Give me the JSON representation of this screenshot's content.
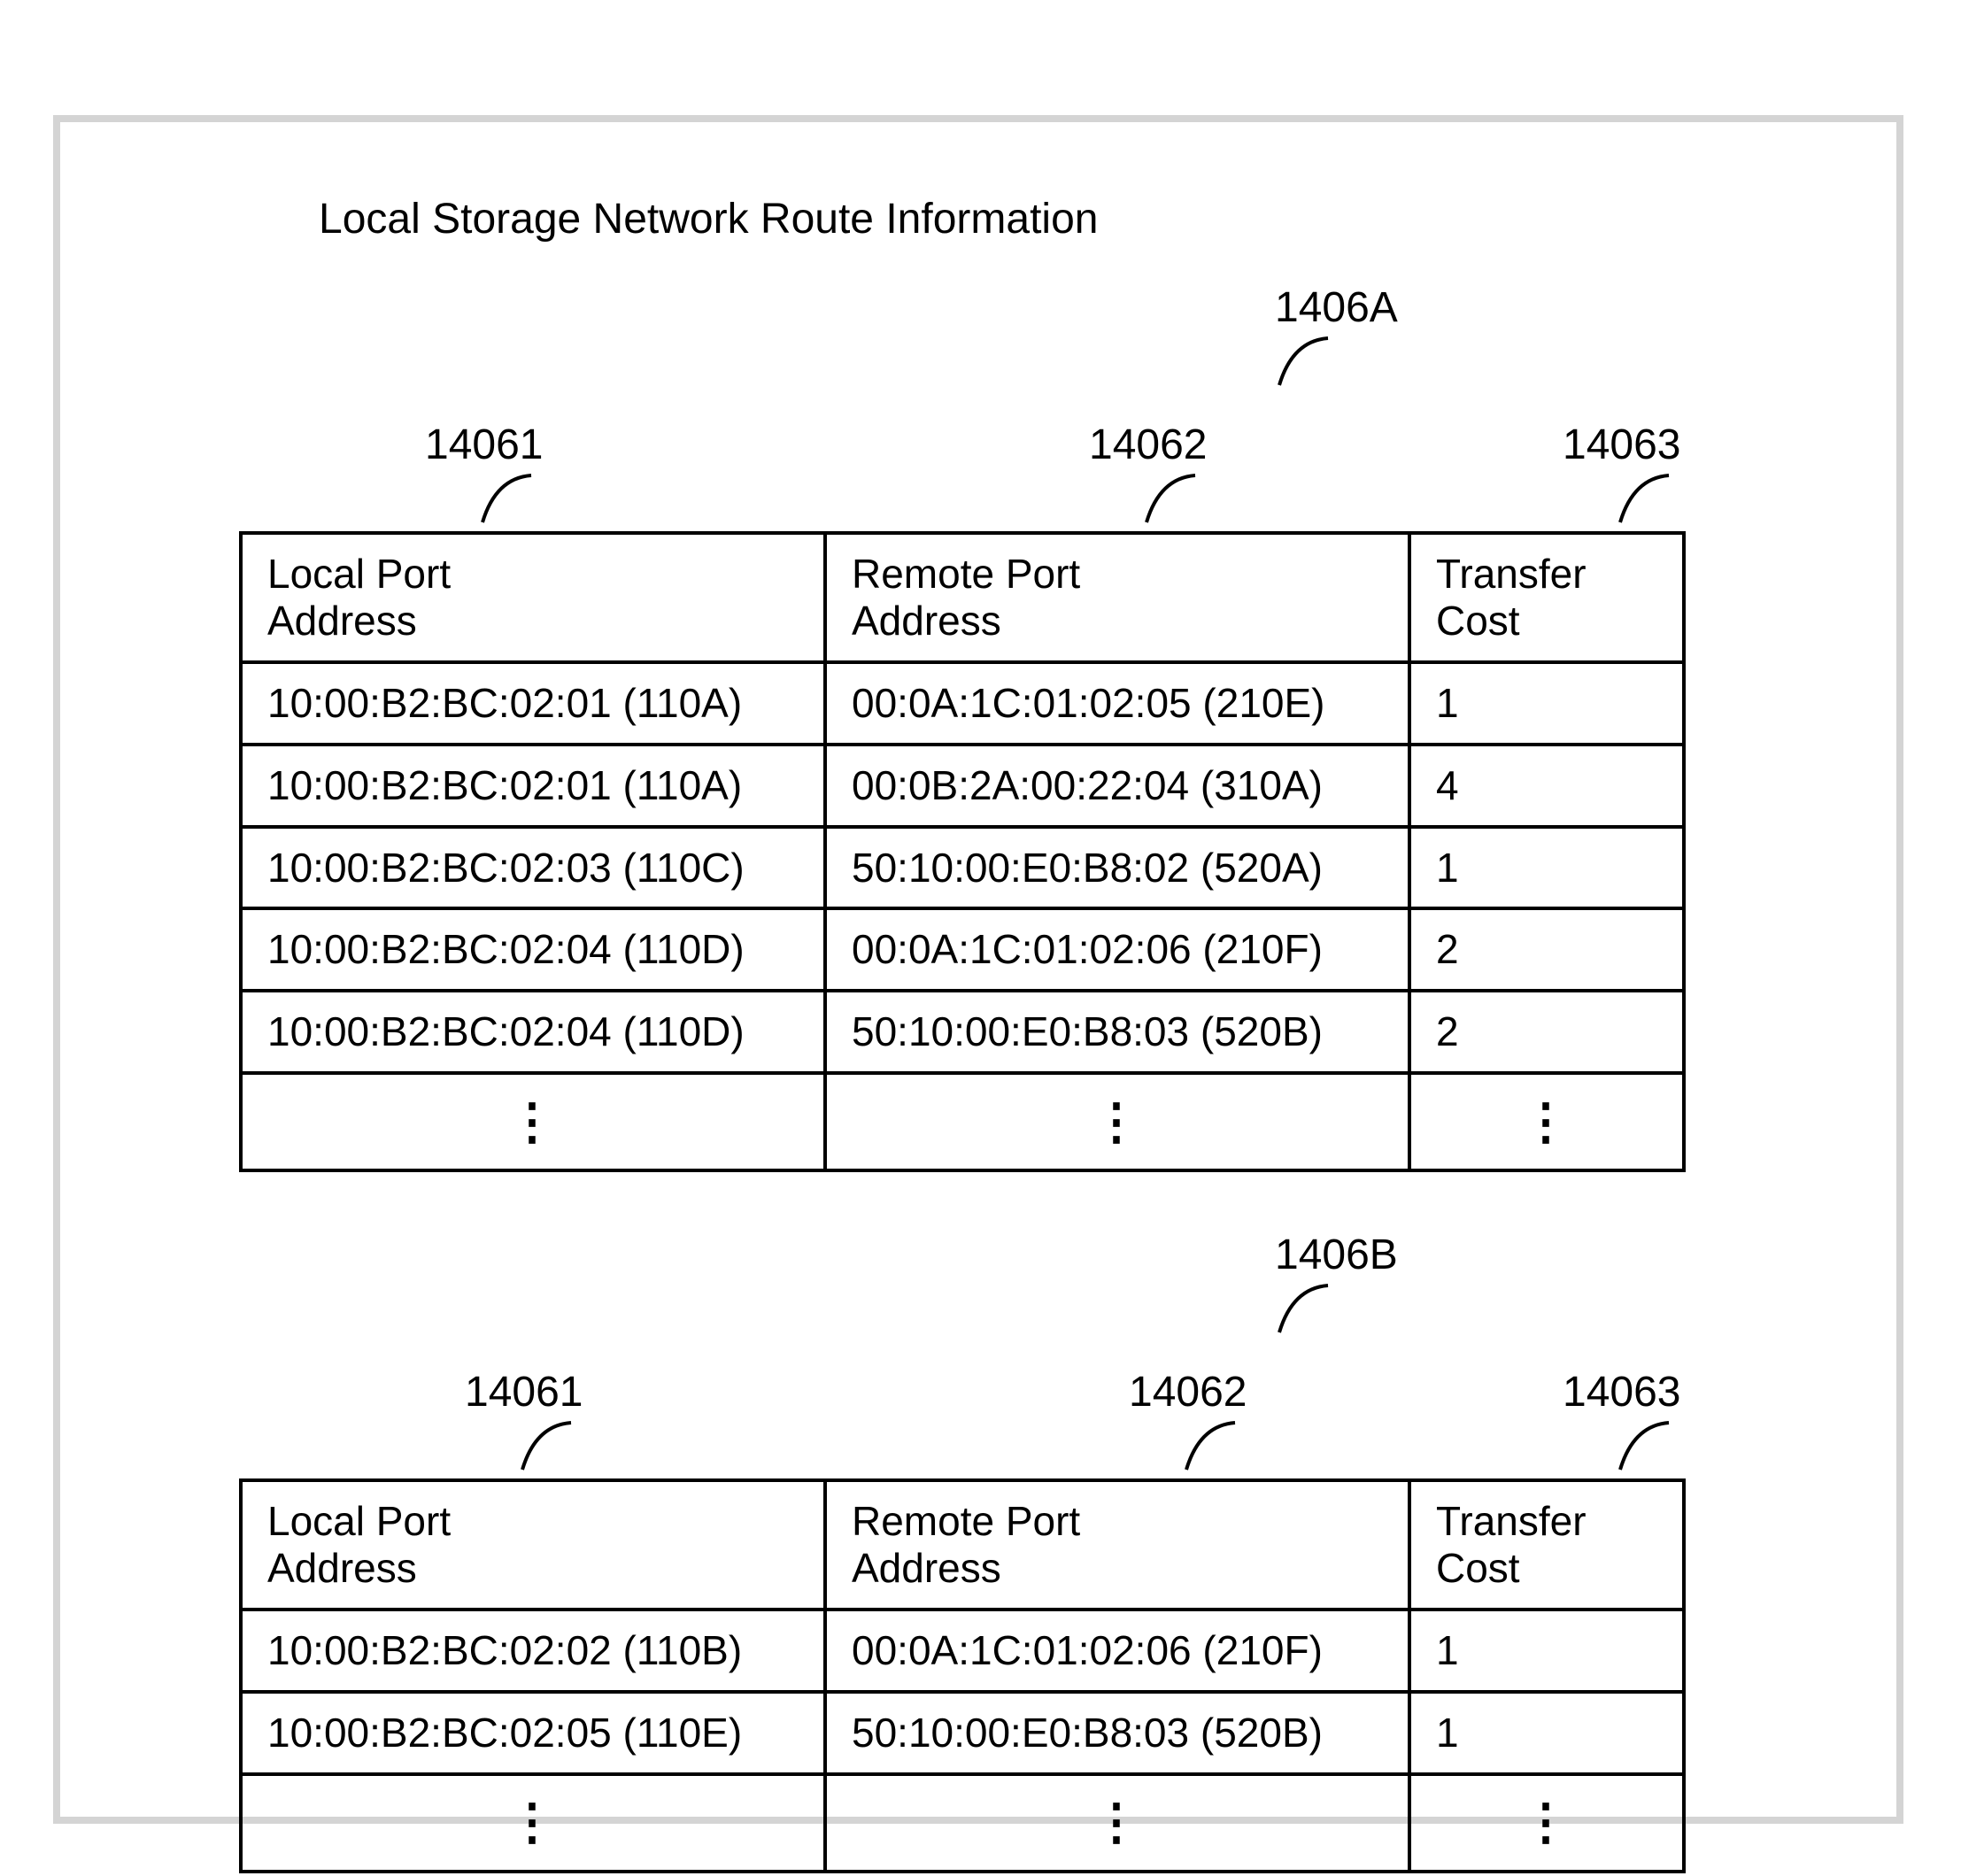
{
  "title": "Local Storage Network Route Information",
  "ellipsis_glyph": "⋮",
  "chart_data": [
    {
      "type": "table",
      "ref": "1406A",
      "col_refs": {
        "local_port": "14061",
        "remote_port": "14062",
        "cost": "14063"
      },
      "columns": [
        "Local Port Address",
        "Remote Port Address",
        "Transfer Cost"
      ],
      "rows": [
        {
          "local_port": "10:00:B2:BC:02:01 (110A)",
          "remote_port": "00:0A:1C:01:02:05 (210E)",
          "cost": "1"
        },
        {
          "local_port": "10:00:B2:BC:02:01 (110A)",
          "remote_port": "00:0B:2A:00:22:04 (310A)",
          "cost": "4"
        },
        {
          "local_port": "10:00:B2:BC:02:03 (110C)",
          "remote_port": "50:10:00:E0:B8:02 (520A)",
          "cost": "1"
        },
        {
          "local_port": "10:00:B2:BC:02:04 (110D)",
          "remote_port": "00:0A:1C:01:02:06 (210F)",
          "cost": "2"
        },
        {
          "local_port": "10:00:B2:BC:02:04 (110D)",
          "remote_port": "50:10:00:E0:B8:03 (520B)",
          "cost": "2"
        }
      ]
    },
    {
      "type": "table",
      "ref": "1406B",
      "col_refs": {
        "local_port": "14061",
        "remote_port": "14062",
        "cost": "14063"
      },
      "columns": [
        "Local Port Address",
        "Remote Port Address",
        "Transfer Cost"
      ],
      "rows": [
        {
          "local_port": "10:00:B2:BC:02:02 (110B)",
          "remote_port": "00:0A:1C:01:02:06 (210F)",
          "cost": "1"
        },
        {
          "local_port": "10:00:B2:BC:02:05 (110E)",
          "remote_port": "50:10:00:E0:B8:03 (520B)",
          "cost": "1"
        }
      ]
    }
  ]
}
